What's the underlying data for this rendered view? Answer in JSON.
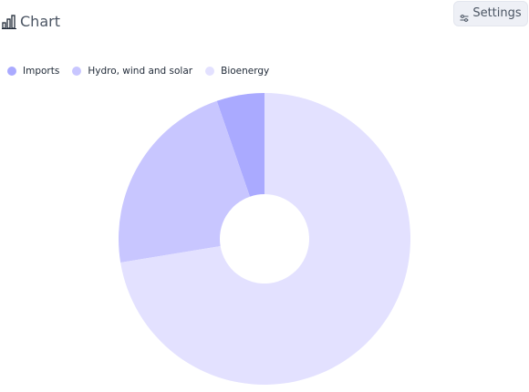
{
  "header": {
    "title": "Chart",
    "title_icon": "bar-chart-icon",
    "settings_label": "Settings",
    "settings_icon": "sliders-icon"
  },
  "colors": {
    "Imports": "#aaaaff",
    "Hydro, wind and solar": "#c8c6ff",
    "Bioenergy": "#e3e1ff"
  },
  "chart_data": {
    "type": "pie",
    "variant": "donut",
    "title": "",
    "legend_position": "top-left",
    "series": [
      {
        "name": "Imports",
        "value": 5.3
      },
      {
        "name": "Hydro, wind and solar",
        "value": 22.3
      },
      {
        "name": "Bioenergy",
        "value": 72.4
      }
    ]
  }
}
